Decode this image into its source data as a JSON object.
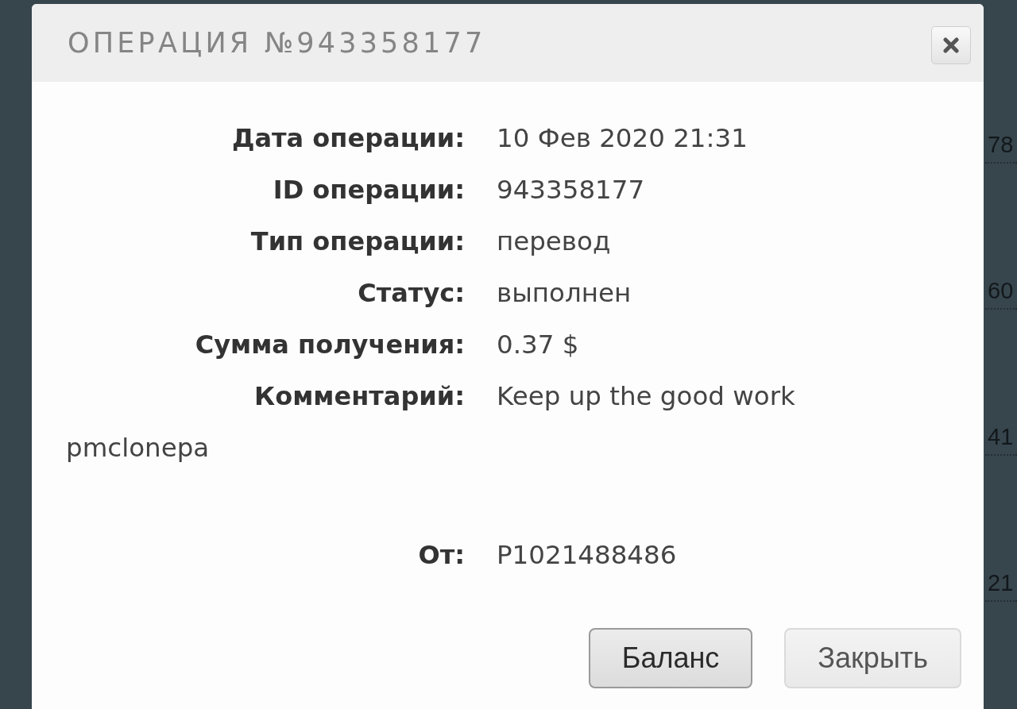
{
  "background_table": {
    "cells": [
      "78",
      "60",
      "41",
      "21"
    ]
  },
  "dialog": {
    "title": "ОПЕРАЦИЯ №943358177",
    "details": [
      {
        "label": "Дата операции:",
        "value": "10 Фев 2020 21:31"
      },
      {
        "label": "ID операции:",
        "value": "943358177"
      },
      {
        "label": "Тип операции:",
        "value": "перевод"
      },
      {
        "label": "Статус:",
        "value": "выполнен"
      },
      {
        "label": "Сумма получения:",
        "value": "0.37 $"
      },
      {
        "label": "Комментарий:",
        "value": "Keep up the good work",
        "wrapped_value": "pmclonepa"
      }
    ],
    "sender": {
      "label": "От:",
      "value": "P1021488486"
    },
    "buttons": [
      {
        "label": "Баланс",
        "focused": true
      },
      {
        "label": "Закрыть",
        "focused": false
      }
    ]
  }
}
